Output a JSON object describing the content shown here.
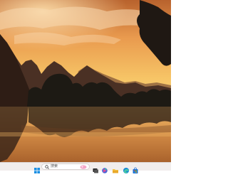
{
  "taskbar": {
    "search_label": "搜索",
    "icons": [
      "windows-start-icon",
      "search-icon",
      "search-highlight-icon",
      "task-view-icon",
      "chat-icon",
      "file-explorer-icon",
      "edge-icon",
      "microsoft-store-icon"
    ]
  },
  "wallpaper": {
    "description_visible": false
  },
  "colors": {
    "sky_top": "#c7733a",
    "sky_glow": "#f6c56a",
    "mountain": "#3a261d",
    "water": "#b5753b",
    "taskbar": "#f1edec",
    "start_blue": "#1a8fe3"
  }
}
